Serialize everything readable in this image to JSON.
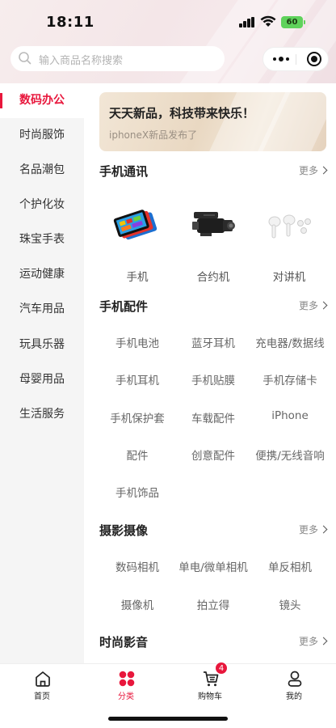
{
  "status_bar": {
    "time": "18:11",
    "battery": "60"
  },
  "search": {
    "placeholder": "输入商品名称搜索"
  },
  "sidebar": {
    "items": [
      {
        "label": "数码办公",
        "active": true
      },
      {
        "label": "时尚服饰"
      },
      {
        "label": "名品潮包"
      },
      {
        "label": "个护化妆"
      },
      {
        "label": "珠宝手表"
      },
      {
        "label": "运动健康"
      },
      {
        "label": "汽车用品"
      },
      {
        "label": "玩具乐器"
      },
      {
        "label": "母婴用品"
      },
      {
        "label": "生活服务"
      }
    ]
  },
  "banner": {
    "title": "天天新品，科技带来快乐！",
    "subtitle": "iphoneX新品发布了"
  },
  "sections": [
    {
      "title": "手机通讯",
      "more": "更多",
      "items": [
        {
          "label": "手机",
          "icon": "tablet-phones-image"
        },
        {
          "label": "合约机",
          "icon": "camcorder-image"
        },
        {
          "label": "对讲机",
          "icon": "earbuds-image"
        }
      ]
    },
    {
      "title": "手机配件",
      "more": "更多",
      "items": [
        "手机电池",
        "蓝牙耳机",
        "充电器/数据线",
        "手机耳机",
        "手机贴膜",
        "手机存储卡",
        "手机保护套",
        "车载配件",
        "iPhone",
        "配件",
        "创意配件",
        "便携/无线音响",
        "手机饰品"
      ]
    },
    {
      "title": "摄影摄像",
      "more": "更多",
      "items": [
        "数码相机",
        "单电/微单相机",
        "单反相机",
        "摄像机",
        "拍立得",
        "镜头"
      ]
    },
    {
      "title": "时尚影音",
      "more": "更多",
      "items": []
    }
  ],
  "tabbar": {
    "items": [
      {
        "label": "首页",
        "icon": "home-icon"
      },
      {
        "label": "分类",
        "icon": "category-icon",
        "active": true
      },
      {
        "label": "购物车",
        "icon": "cart-icon",
        "badge": "4"
      },
      {
        "label": "我的",
        "icon": "user-icon"
      }
    ]
  },
  "colors": {
    "accent": "#e8173c",
    "sidebar_bg": "#f5f5f5",
    "banner_bg": "#ecdcc8"
  }
}
